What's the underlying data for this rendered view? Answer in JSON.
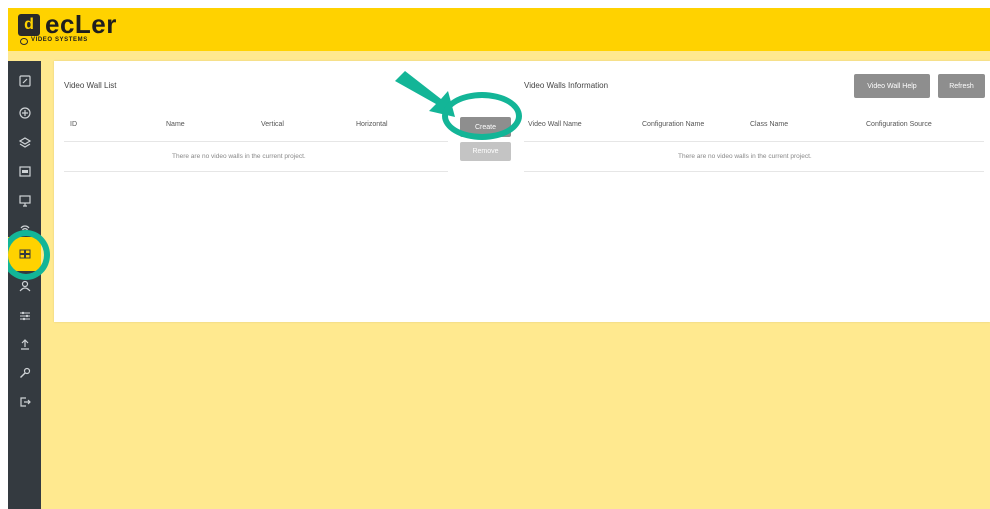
{
  "header": {
    "brand_mark": "d",
    "brand_name": "ecLer",
    "brand_sub": "VIDEO SYSTEMS",
    "bg_color": "#ffd200"
  },
  "sidebar": {
    "bg_color": "#343a40",
    "active_color": "#ffd200",
    "items": [
      {
        "icon": "dashboard-icon"
      },
      {
        "icon": "add-circle-icon"
      },
      {
        "icon": "layers-icon"
      },
      {
        "icon": "display-icon"
      },
      {
        "icon": "monitor-icon"
      },
      {
        "icon": "signal-icon"
      },
      {
        "icon": "video-wall-icon",
        "active": true
      },
      {
        "icon": "user-icon"
      },
      {
        "icon": "sliders-icon"
      },
      {
        "icon": "upload-icon"
      },
      {
        "icon": "wrench-icon"
      },
      {
        "icon": "logout-icon"
      }
    ]
  },
  "video_wall_list": {
    "title": "Video Wall List",
    "columns": [
      "ID",
      "Name",
      "Vertical",
      "Horizontal"
    ],
    "empty_message": "There are no video walls in the current project."
  },
  "actions": {
    "create_label": "Create",
    "remove_label": "Remove"
  },
  "video_walls_info": {
    "title": "Video Walls Information",
    "help_label": "Video Wall Help",
    "refresh_label": "Refresh",
    "columns": [
      "Video Wall Name",
      "Configuration Name",
      "Class Name",
      "Configuration Source"
    ],
    "empty_message": "There are no video walls in the current project."
  },
  "annotation_color": "#13b597"
}
